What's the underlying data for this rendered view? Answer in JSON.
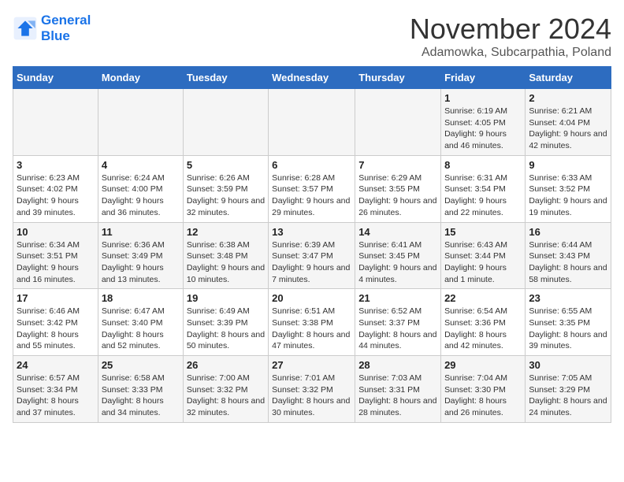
{
  "header": {
    "logo_line1": "General",
    "logo_line2": "Blue",
    "month": "November 2024",
    "location": "Adamowka, Subcarpathia, Poland"
  },
  "weekdays": [
    "Sunday",
    "Monday",
    "Tuesday",
    "Wednesday",
    "Thursday",
    "Friday",
    "Saturday"
  ],
  "weeks": [
    [
      {
        "day": "",
        "info": ""
      },
      {
        "day": "",
        "info": ""
      },
      {
        "day": "",
        "info": ""
      },
      {
        "day": "",
        "info": ""
      },
      {
        "day": "",
        "info": ""
      },
      {
        "day": "1",
        "info": "Sunrise: 6:19 AM\nSunset: 4:05 PM\nDaylight: 9 hours and 46 minutes."
      },
      {
        "day": "2",
        "info": "Sunrise: 6:21 AM\nSunset: 4:04 PM\nDaylight: 9 hours and 42 minutes."
      }
    ],
    [
      {
        "day": "3",
        "info": "Sunrise: 6:23 AM\nSunset: 4:02 PM\nDaylight: 9 hours and 39 minutes."
      },
      {
        "day": "4",
        "info": "Sunrise: 6:24 AM\nSunset: 4:00 PM\nDaylight: 9 hours and 36 minutes."
      },
      {
        "day": "5",
        "info": "Sunrise: 6:26 AM\nSunset: 3:59 PM\nDaylight: 9 hours and 32 minutes."
      },
      {
        "day": "6",
        "info": "Sunrise: 6:28 AM\nSunset: 3:57 PM\nDaylight: 9 hours and 29 minutes."
      },
      {
        "day": "7",
        "info": "Sunrise: 6:29 AM\nSunset: 3:55 PM\nDaylight: 9 hours and 26 minutes."
      },
      {
        "day": "8",
        "info": "Sunrise: 6:31 AM\nSunset: 3:54 PM\nDaylight: 9 hours and 22 minutes."
      },
      {
        "day": "9",
        "info": "Sunrise: 6:33 AM\nSunset: 3:52 PM\nDaylight: 9 hours and 19 minutes."
      }
    ],
    [
      {
        "day": "10",
        "info": "Sunrise: 6:34 AM\nSunset: 3:51 PM\nDaylight: 9 hours and 16 minutes."
      },
      {
        "day": "11",
        "info": "Sunrise: 6:36 AM\nSunset: 3:49 PM\nDaylight: 9 hours and 13 minutes."
      },
      {
        "day": "12",
        "info": "Sunrise: 6:38 AM\nSunset: 3:48 PM\nDaylight: 9 hours and 10 minutes."
      },
      {
        "day": "13",
        "info": "Sunrise: 6:39 AM\nSunset: 3:47 PM\nDaylight: 9 hours and 7 minutes."
      },
      {
        "day": "14",
        "info": "Sunrise: 6:41 AM\nSunset: 3:45 PM\nDaylight: 9 hours and 4 minutes."
      },
      {
        "day": "15",
        "info": "Sunrise: 6:43 AM\nSunset: 3:44 PM\nDaylight: 9 hours and 1 minute."
      },
      {
        "day": "16",
        "info": "Sunrise: 6:44 AM\nSunset: 3:43 PM\nDaylight: 8 hours and 58 minutes."
      }
    ],
    [
      {
        "day": "17",
        "info": "Sunrise: 6:46 AM\nSunset: 3:42 PM\nDaylight: 8 hours and 55 minutes."
      },
      {
        "day": "18",
        "info": "Sunrise: 6:47 AM\nSunset: 3:40 PM\nDaylight: 8 hours and 52 minutes."
      },
      {
        "day": "19",
        "info": "Sunrise: 6:49 AM\nSunset: 3:39 PM\nDaylight: 8 hours and 50 minutes."
      },
      {
        "day": "20",
        "info": "Sunrise: 6:51 AM\nSunset: 3:38 PM\nDaylight: 8 hours and 47 minutes."
      },
      {
        "day": "21",
        "info": "Sunrise: 6:52 AM\nSunset: 3:37 PM\nDaylight: 8 hours and 44 minutes."
      },
      {
        "day": "22",
        "info": "Sunrise: 6:54 AM\nSunset: 3:36 PM\nDaylight: 8 hours and 42 minutes."
      },
      {
        "day": "23",
        "info": "Sunrise: 6:55 AM\nSunset: 3:35 PM\nDaylight: 8 hours and 39 minutes."
      }
    ],
    [
      {
        "day": "24",
        "info": "Sunrise: 6:57 AM\nSunset: 3:34 PM\nDaylight: 8 hours and 37 minutes."
      },
      {
        "day": "25",
        "info": "Sunrise: 6:58 AM\nSunset: 3:33 PM\nDaylight: 8 hours and 34 minutes."
      },
      {
        "day": "26",
        "info": "Sunrise: 7:00 AM\nSunset: 3:32 PM\nDaylight: 8 hours and 32 minutes."
      },
      {
        "day": "27",
        "info": "Sunrise: 7:01 AM\nSunset: 3:32 PM\nDaylight: 8 hours and 30 minutes."
      },
      {
        "day": "28",
        "info": "Sunrise: 7:03 AM\nSunset: 3:31 PM\nDaylight: 8 hours and 28 minutes."
      },
      {
        "day": "29",
        "info": "Sunrise: 7:04 AM\nSunset: 3:30 PM\nDaylight: 8 hours and 26 minutes."
      },
      {
        "day": "30",
        "info": "Sunrise: 7:05 AM\nSunset: 3:29 PM\nDaylight: 8 hours and 24 minutes."
      }
    ]
  ]
}
